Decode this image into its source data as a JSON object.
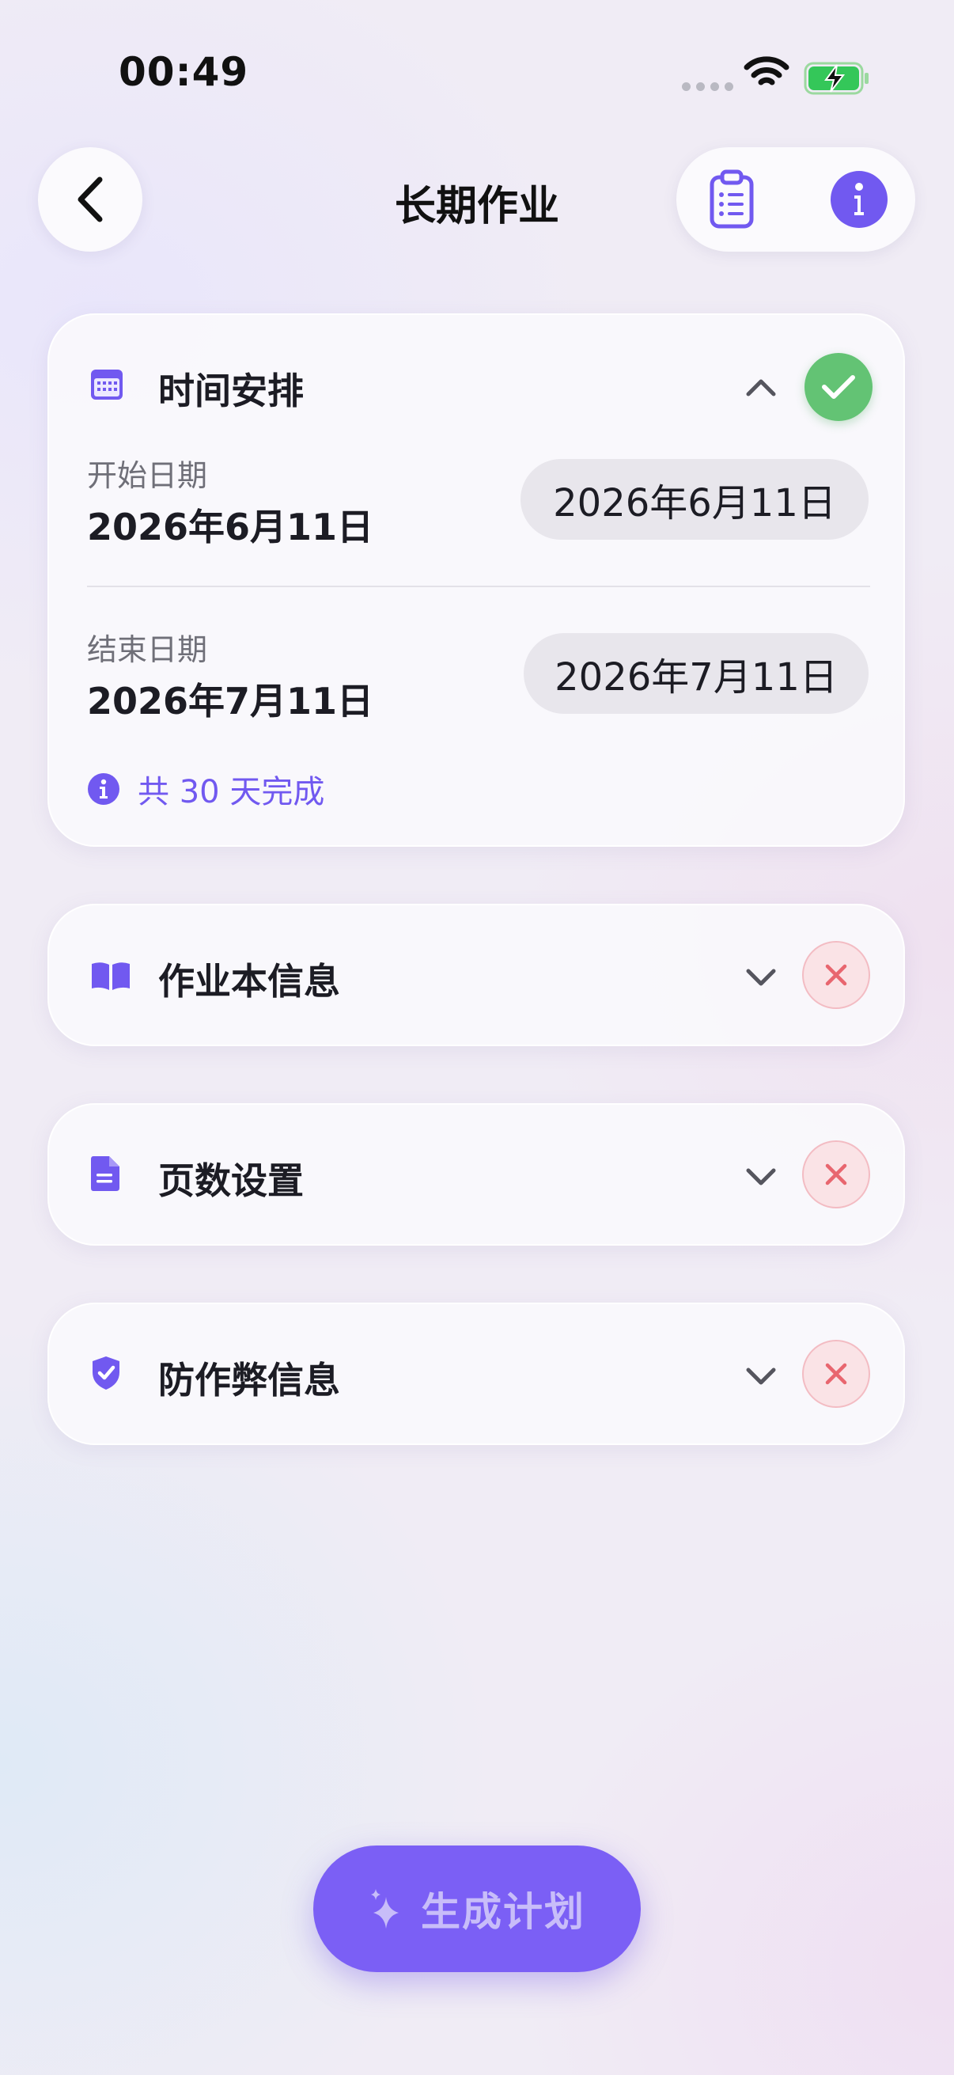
{
  "status_bar": {
    "time": "00:49"
  },
  "nav": {
    "title": "长期作业"
  },
  "sections": {
    "schedule": {
      "title": "时间安排",
      "start_label": "开始日期",
      "start_value": "2026年6月11日",
      "start_picker": "2026年6月11日",
      "end_label": "结束日期",
      "end_value": "2026年7月11日",
      "end_picker": "2026年7月11日",
      "duration_note": "共 30 天完成",
      "state": "complete",
      "expanded": true
    },
    "workbook": {
      "title": "作业本信息",
      "state": "incomplete",
      "expanded": false
    },
    "pages": {
      "title": "页数设置",
      "state": "incomplete",
      "expanded": false
    },
    "anti_cheat": {
      "title": "防作弊信息",
      "state": "incomplete",
      "expanded": false
    }
  },
  "generate_button": {
    "label": "生成计划"
  },
  "colors": {
    "accent": "#7159f0",
    "success": "#63c374",
    "error": "#e8666f"
  }
}
